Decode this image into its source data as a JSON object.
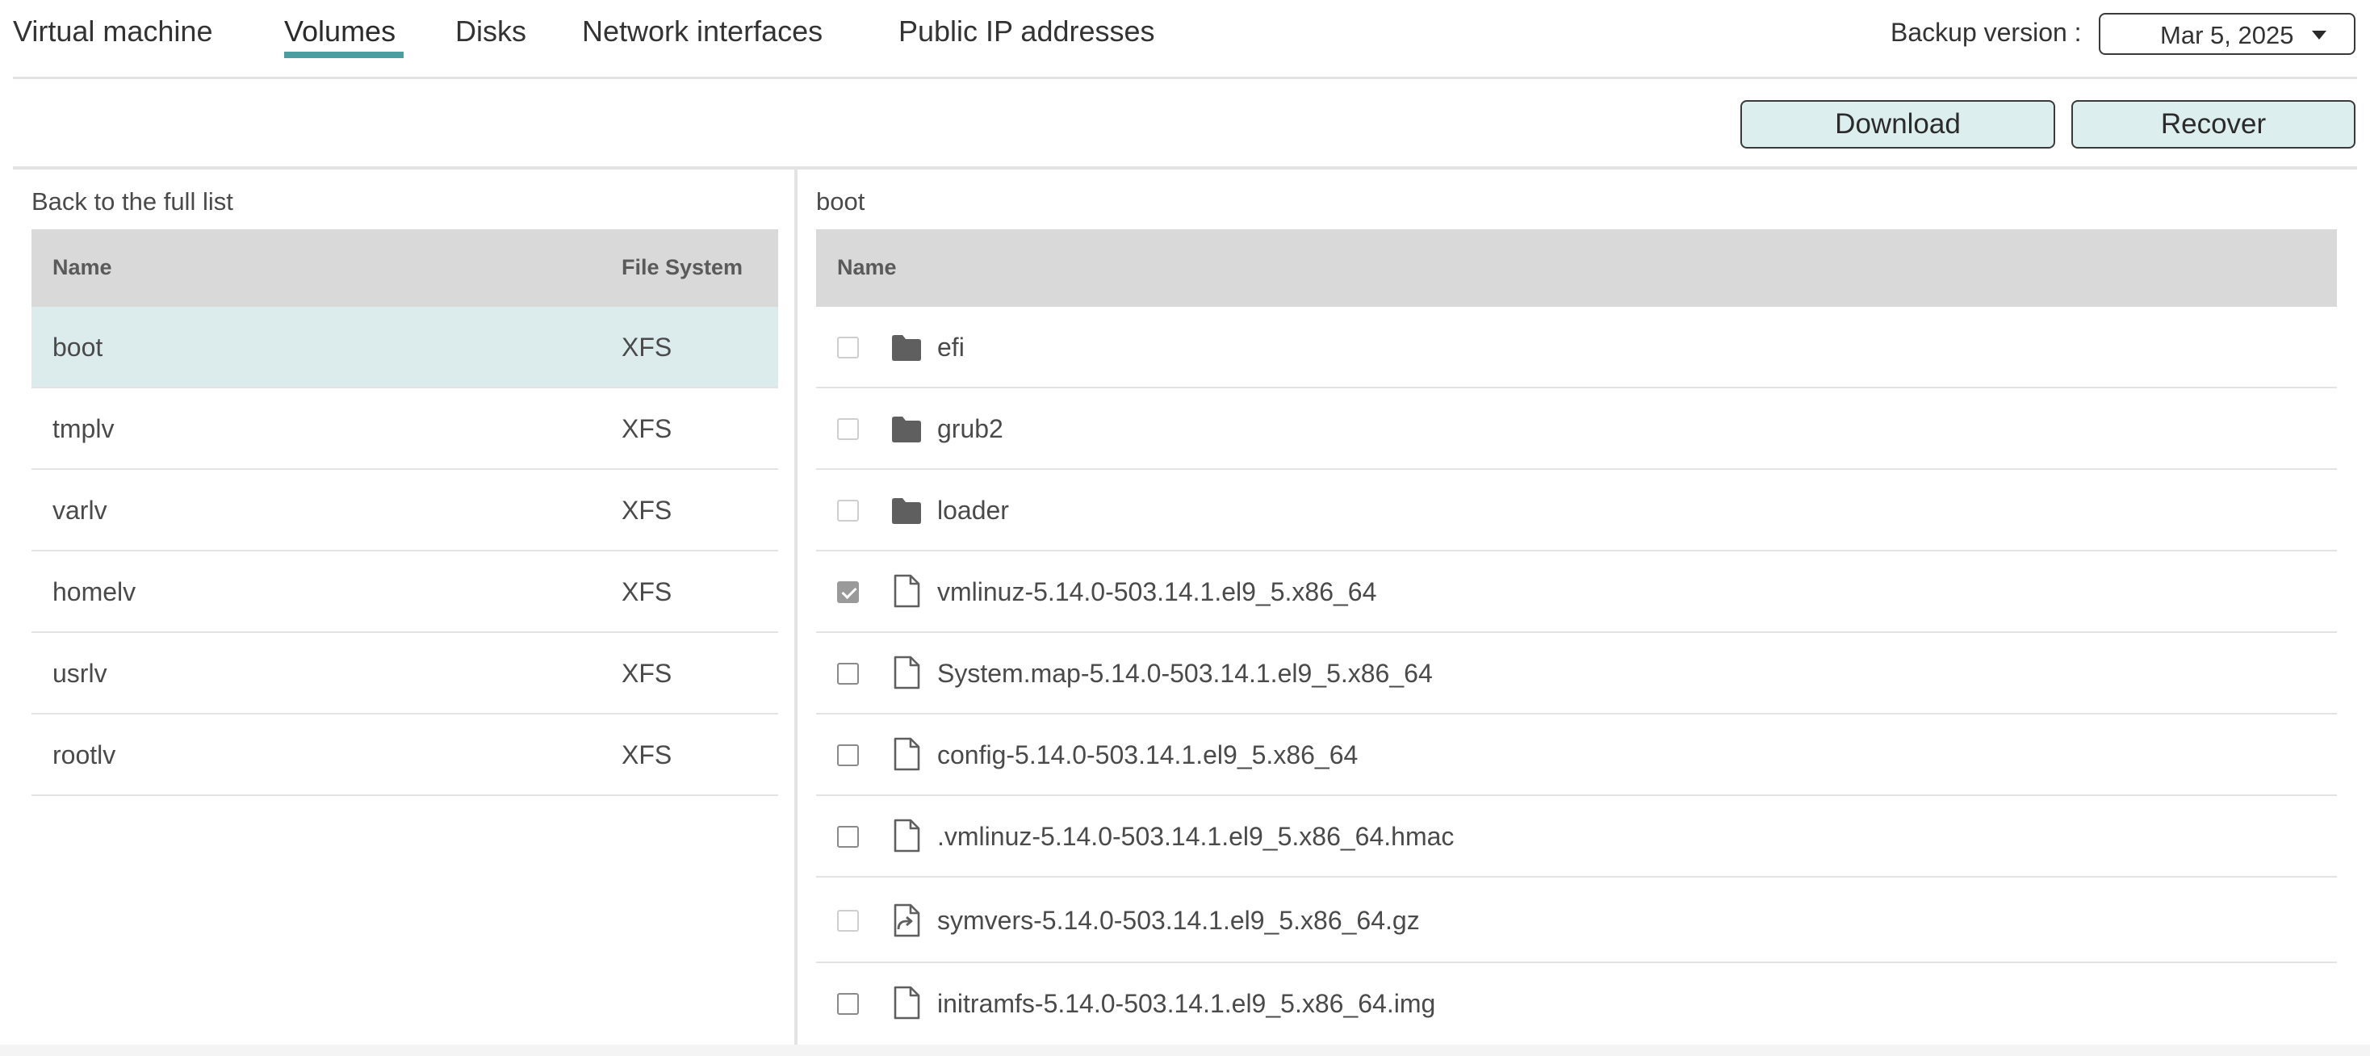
{
  "tabs": [
    {
      "label": "Virtual machine",
      "active": false
    },
    {
      "label": "Volumes",
      "active": true
    },
    {
      "label": "Disks",
      "active": false
    },
    {
      "label": "Network interfaces",
      "active": false
    },
    {
      "label": "Public IP addresses",
      "active": false
    }
  ],
  "backup": {
    "label": "Backup version :",
    "selected": "Mar 5, 2025"
  },
  "actions": {
    "download_label": "Download",
    "recover_label": "Recover"
  },
  "volumes": {
    "back_link": "Back to the full list",
    "columns": {
      "name": "Name",
      "file_system": "File System"
    },
    "rows": [
      {
        "name": "boot",
        "fs": "XFS",
        "selected": true
      },
      {
        "name": "tmplv",
        "fs": "XFS",
        "selected": false
      },
      {
        "name": "varlv",
        "fs": "XFS",
        "selected": false
      },
      {
        "name": "homelv",
        "fs": "XFS",
        "selected": false
      },
      {
        "name": "usrlv",
        "fs": "XFS",
        "selected": false
      },
      {
        "name": "rootlv",
        "fs": "XFS",
        "selected": false
      }
    ]
  },
  "files": {
    "path": "boot",
    "columns": {
      "name": "Name"
    },
    "rows": [
      {
        "name": "efi",
        "icon": "folder-icon",
        "checked": false
      },
      {
        "name": "grub2",
        "icon": "folder-icon",
        "checked": false
      },
      {
        "name": "loader",
        "icon": "folder-icon",
        "checked": false
      },
      {
        "name": "vmlinuz-5.14.0-503.14.1.el9_5.x86_64",
        "icon": "file-icon",
        "checked": true
      },
      {
        "name": "System.map-5.14.0-503.14.1.el9_5.x86_64",
        "icon": "file-icon",
        "checked": false
      },
      {
        "name": "config-5.14.0-503.14.1.el9_5.x86_64",
        "icon": "file-icon",
        "checked": false
      },
      {
        "name": ".vmlinuz-5.14.0-503.14.1.el9_5.x86_64.hmac",
        "icon": "file-icon",
        "checked": false
      },
      {
        "name": "symvers-5.14.0-503.14.1.el9_5.x86_64.gz",
        "icon": "symlink-file-icon",
        "checked": false
      },
      {
        "name": "initramfs-5.14.0-503.14.1.el9_5.x86_64.img",
        "icon": "file-icon",
        "checked": false
      }
    ]
  },
  "colors": {
    "accent": "#4a9ea0",
    "selected_row": "#dcecec",
    "button_bg": "#ddeeee",
    "header_bg": "#d9d9d9"
  }
}
